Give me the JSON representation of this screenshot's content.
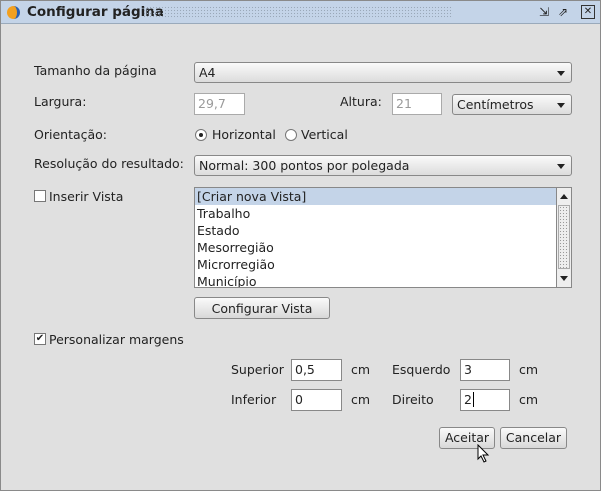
{
  "window": {
    "title": "Configurar página"
  },
  "page_size": {
    "label": "Tamanho da página",
    "value": "A4"
  },
  "width": {
    "label": "Largura:",
    "value": "29,7"
  },
  "height": {
    "label": "Altura:",
    "value": "21"
  },
  "units": {
    "value": "Centímetros"
  },
  "orientation": {
    "label": "Orientação:",
    "options": [
      "Horizontal",
      "Vertical"
    ],
    "selected": "Horizontal"
  },
  "resolution": {
    "label": "Resolução do resultado:",
    "value": "Normal: 300 pontos por polegada"
  },
  "insert_view": {
    "label": "Inserir Vista",
    "checked": false,
    "items": [
      "[Criar nova Vista]",
      "Trabalho",
      "Estado",
      "Mesorregião",
      "Microrregião",
      "Município"
    ],
    "selected": "[Criar nova Vista]",
    "configure_label": "Configurar Vista"
  },
  "margins": {
    "label": "Personalizar margens",
    "checked": true,
    "unit": "cm",
    "superior": {
      "label": "Superior",
      "value": "0,5"
    },
    "inferior": {
      "label": "Inferior",
      "value": "0"
    },
    "esquerdo": {
      "label": "Esquerdo",
      "value": "3"
    },
    "direito": {
      "label": "Direito",
      "value": "2"
    }
  },
  "buttons": {
    "accept": "Aceitar",
    "cancel": "Cancelar"
  }
}
